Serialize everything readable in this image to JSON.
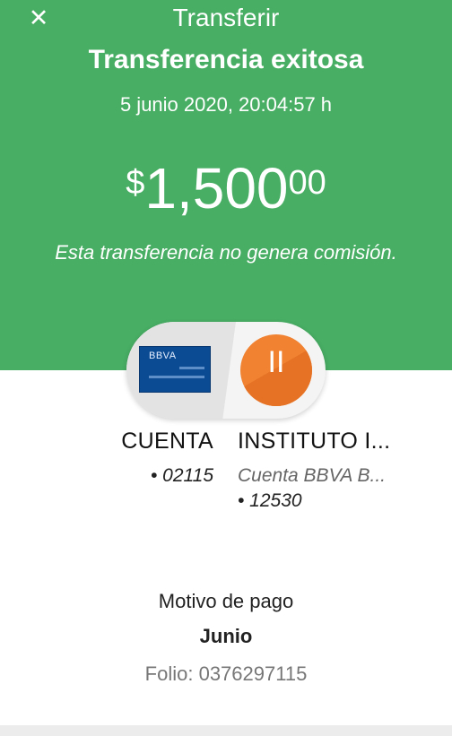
{
  "header": {
    "close_icon": "close-icon",
    "title": "Transferir"
  },
  "status": {
    "heading": "Transferencia exitosa",
    "datetime": "5 junio 2020, 20:04:57 h"
  },
  "amount": {
    "currency": "$",
    "integer": "1,500",
    "decimals": "00"
  },
  "note": "Esta transferencia no genera comisión.",
  "transfer": {
    "origin": {
      "card_brand": "BBVA",
      "name": "CUENTA",
      "number": "• 02115"
    },
    "destination": {
      "initials": "II",
      "name": "INSTITUTO I...",
      "bank": "Cuenta BBVA B...",
      "number": "• 12530"
    },
    "colors": {
      "green": "#48ae64",
      "card_blue": "#0b4b94",
      "avatar_orange": "#f08232"
    }
  },
  "payment": {
    "reason_label": "Motivo de pago",
    "reason_value": "Junio",
    "folio": "Folio: 0376297115"
  }
}
